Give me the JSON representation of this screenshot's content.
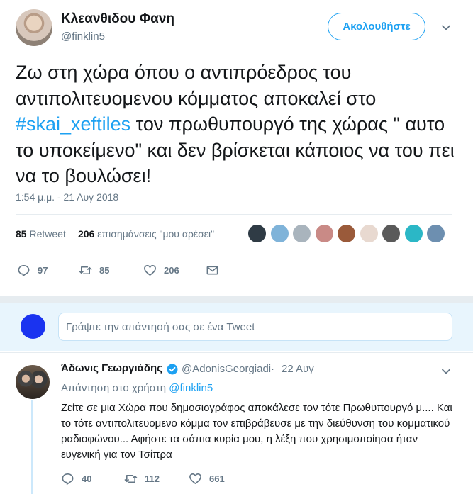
{
  "main_tweet": {
    "author_name": "Κλεανθιδου Φανη",
    "author_handle": "@finklin5",
    "follow_label": "Ακολουθήστε",
    "text_before_hashtag": "Ζω στη χώρα όπου ο αντιπρόεδρος του αντιπολιτευομενου κόμματος αποκαλεί στο ",
    "hashtag": "#skai_xeftiles",
    "text_after_hashtag": " τον πρωθυπουργό της χώρας \" αυτο το υποκείμενο\" και δεν βρίσκεται κάποιος να του πει να το βουλώσει!",
    "timestamp": "1:54 μ.μ. - 21 Αυγ 2018",
    "retweets_count": "85",
    "retweets_label": "Retweet",
    "likes_count": "206",
    "likes_label": "επισημάνσεις \"μου αρέσει\"",
    "actions": {
      "replies": "97",
      "retweets": "85",
      "likes": "206"
    },
    "liker_colors": [
      "#2f3b45",
      "#7fb3d9",
      "#a9b4bd",
      "#c98a86",
      "#9a5a3a",
      "#e8d9d0",
      "#5a5a5a",
      "#2bb7c6",
      "#6d8fb0"
    ]
  },
  "composer": {
    "placeholder": "Γράψτε την απάντησή σας σε ένα Tweet"
  },
  "reply_tweet": {
    "author_name": "Άδωνις Γεωργιάδης",
    "author_handle": "@AdonisGeorgiadi",
    "separator": "·",
    "date": "22 Αυγ",
    "replying_to_label": "Απάντηση στο χρήστη",
    "replying_to_handle": "@finklin5",
    "text": "Ζείτε σε μια Χώρα που δημοσιογράφος αποκάλεσε τον τότε Πρωθυπουργό μ.... Και το τότε αντιπολιτευομενο κόμμα τον επιβράβευσε με την διεύθυνση του κομματικού ραδιοφώνου... Αφήστε τα σάπια κυρία μου, η λέξη που χρησιμοποίησα ήταν ευγενική για τον Τσίπρα",
    "actions": {
      "replies": "40",
      "retweets": "112",
      "likes": "661"
    }
  },
  "colors": {
    "accent": "#1da1f2",
    "secondary_text": "#657786",
    "composer_bg": "#e8f5fd",
    "composer_avatar": "#1a33f0"
  }
}
